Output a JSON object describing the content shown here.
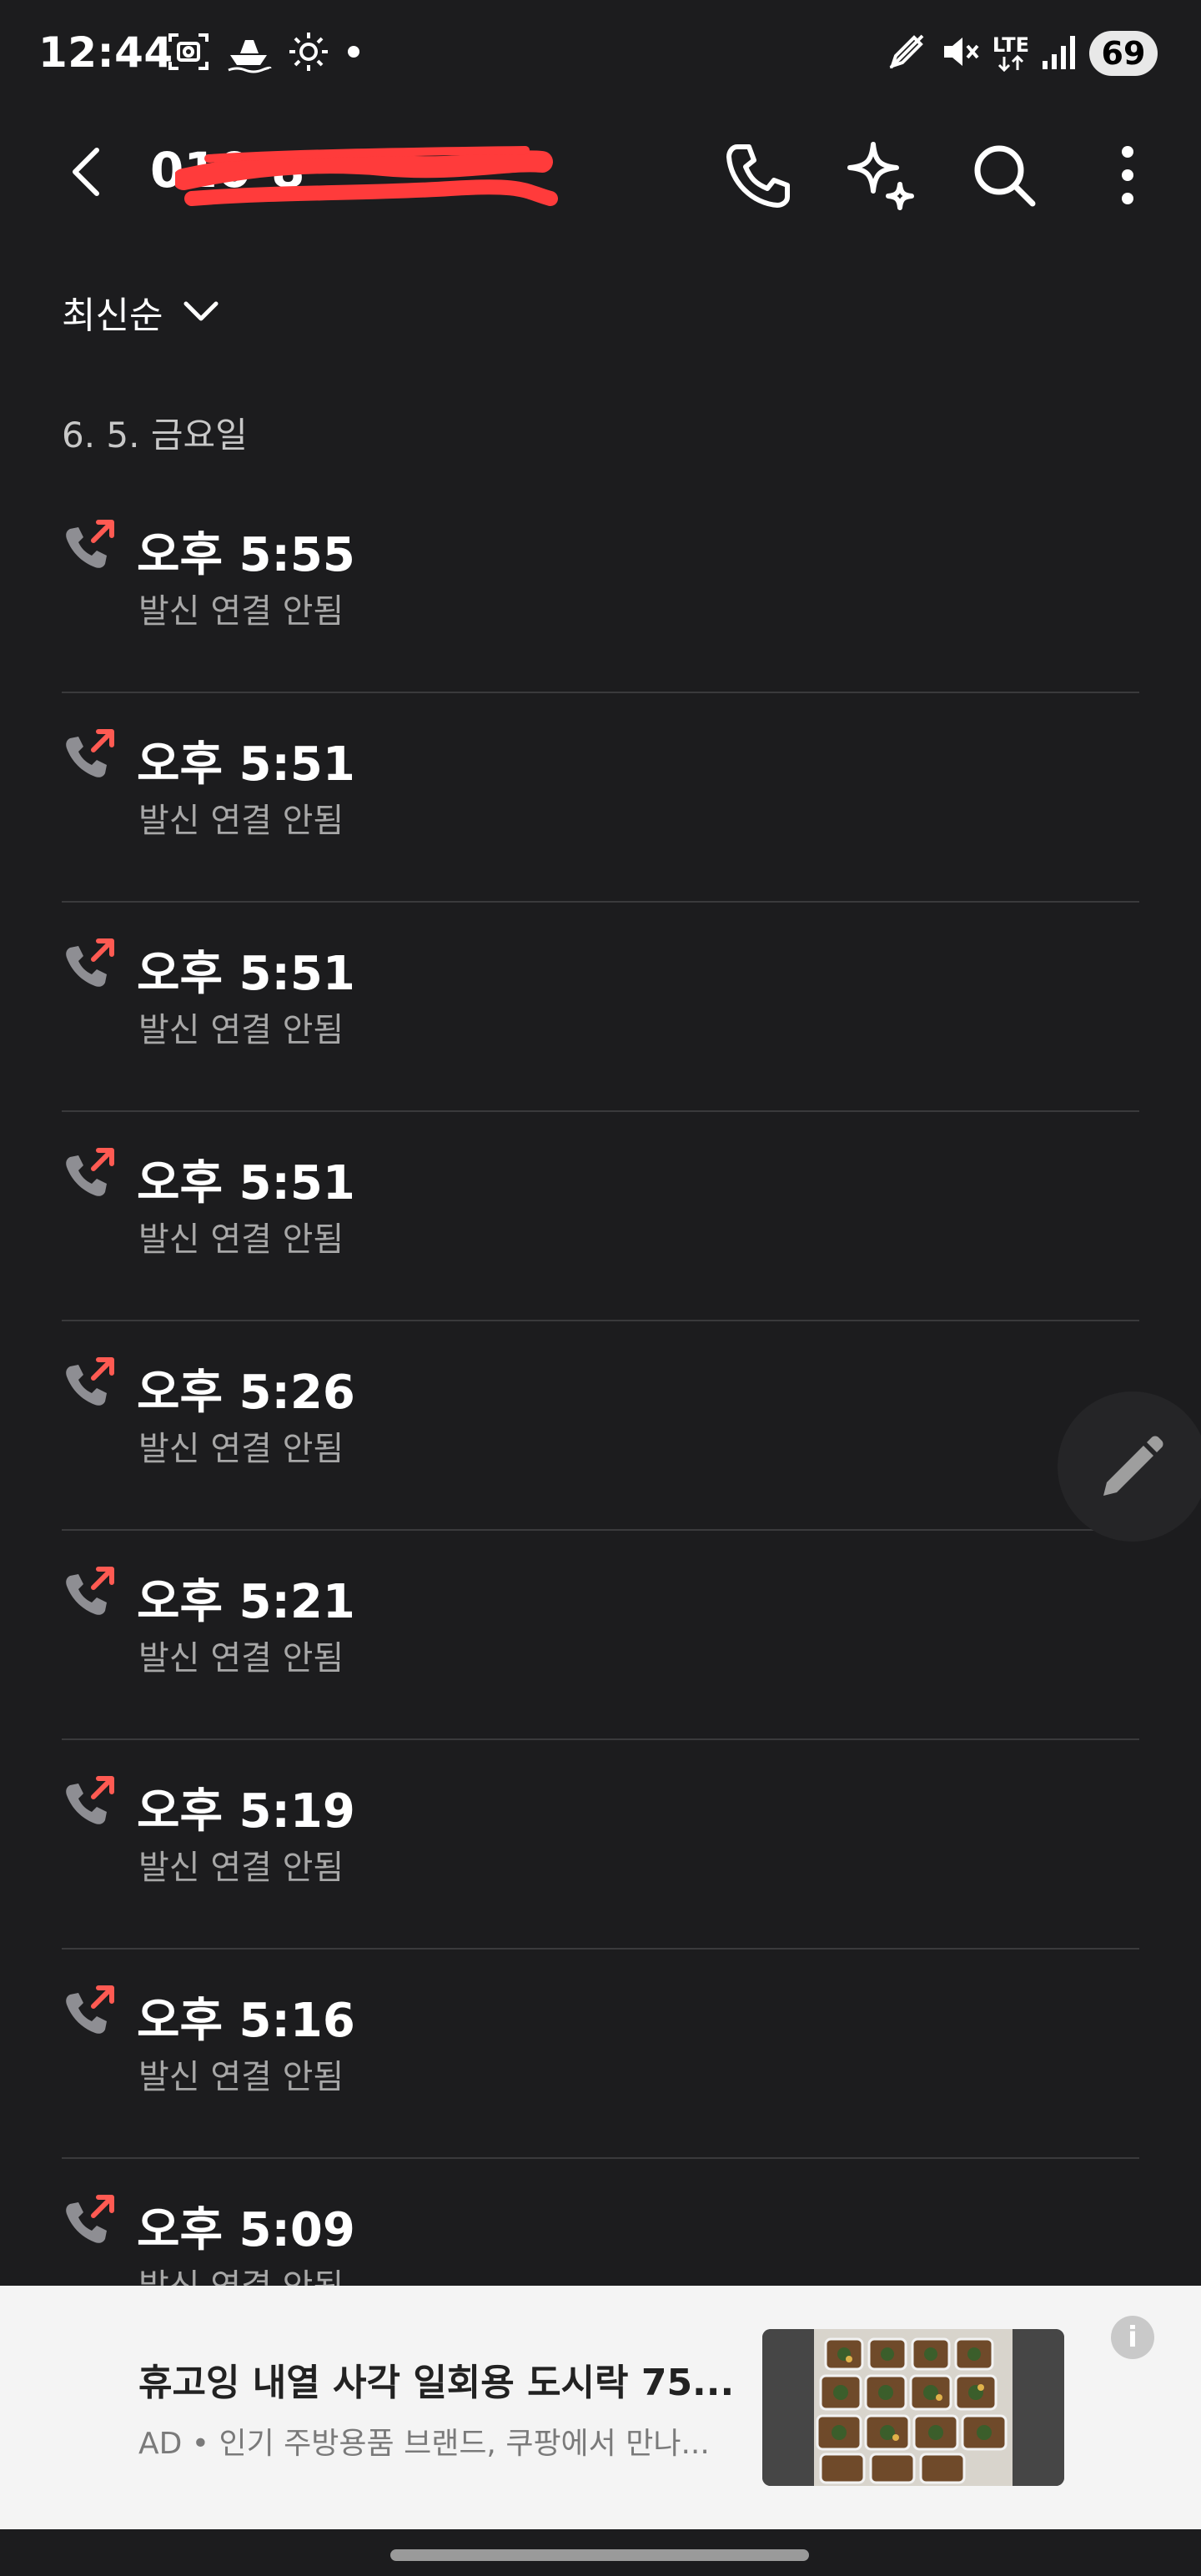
{
  "status_bar": {
    "time": "12:44",
    "battery": "69",
    "network": "LTE",
    "left_icons": [
      "screenshot-icon",
      "boat-icon",
      "sun-icon",
      "dot-icon"
    ],
    "right_icons": [
      "pen-icon",
      "mute-icon",
      "lte-icon",
      "signal-icon"
    ]
  },
  "header": {
    "title": "010-8",
    "back_icon": "chevron-left-icon",
    "actions": [
      "phone-icon",
      "sparkle-icon",
      "search-icon",
      "more-vert-icon"
    ]
  },
  "sort": {
    "label": "최신순"
  },
  "date_header": "6. 5. 금요일",
  "calls": [
    {
      "time": "오후 5:55",
      "status": "발신 연결 안됨"
    },
    {
      "time": "오후 5:51",
      "status": "발신 연결 안됨"
    },
    {
      "time": "오후 5:51",
      "status": "발신 연결 안됨"
    },
    {
      "time": "오후 5:51",
      "status": "발신 연결 안됨"
    },
    {
      "time": "오후 5:26",
      "status": "발신 연결 안됨"
    },
    {
      "time": "오후 5:21",
      "status": "발신 연결 안됨"
    },
    {
      "time": "오후 5:19",
      "status": "발신 연결 안됨"
    },
    {
      "time": "오후 5:16",
      "status": "발신 연결 안됨"
    },
    {
      "time": "오후 5:09",
      "status": "발신 연결 안됨"
    }
  ],
  "ad": {
    "title": "휴고잉 내열 사각 일회용 도시락 75...",
    "description": "AD • 인기 주방용품 브랜드, 쿠팡에서 만나...",
    "info_glyph": "i"
  },
  "colors": {
    "background": "#1c1c1e",
    "divider": "#3a3a3c",
    "outgoing_arrow": "#ff5a52",
    "secondary_text": "#a7a7a7",
    "redaction": "#ff3b3b"
  }
}
